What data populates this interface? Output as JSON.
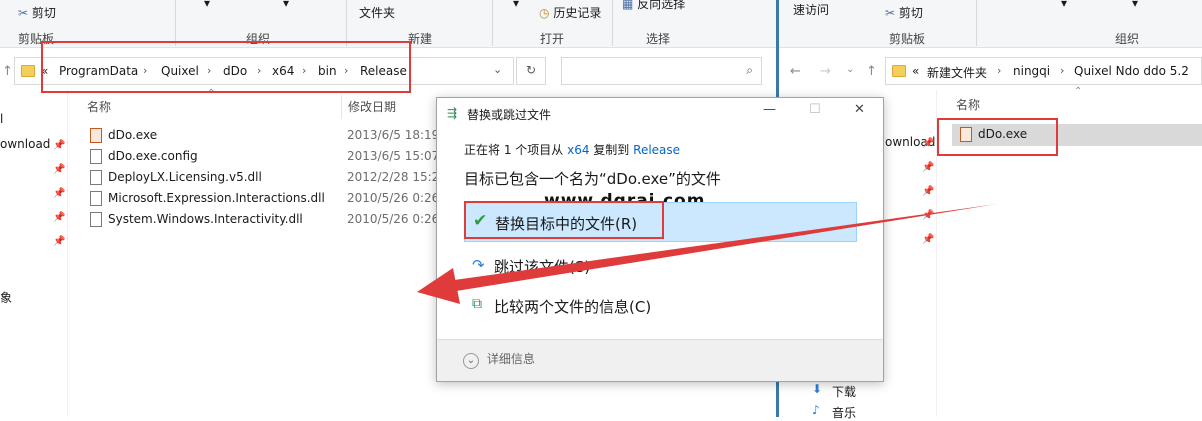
{
  "left_window": {
    "ribbon": {
      "cut": "剪切",
      "clipboard": "剪贴板",
      "organize": "组织",
      "folder": "文件夹",
      "new": "新建",
      "history": "历史记录",
      "open": "打开",
      "invert_select": "反向选择",
      "select": "选择"
    },
    "breadcrumb": [
      "«",
      "ProgramData",
      "Quixel",
      "dDo",
      "x64",
      "bin",
      "Release"
    ],
    "columns": {
      "name": "名称",
      "modified": "修改日期"
    },
    "side_labels": {
      "download": "ownload",
      "misc": "象"
    },
    "files": [
      {
        "name": "dDo.exe",
        "date": "2013/6/5 18:19",
        "type": "exe"
      },
      {
        "name": "dDo.exe.config",
        "date": "2013/6/5 15:07",
        "type": "file"
      },
      {
        "name": "DeployLX.Licensing.v5.dll",
        "date": "2012/2/28 15:24",
        "type": "dll"
      },
      {
        "name": "Microsoft.Expression.Interactions.dll",
        "date": "2010/5/26 0:26",
        "type": "dll"
      },
      {
        "name": "System.Windows.Interactivity.dll",
        "date": "2010/5/26 0:26",
        "type": "dll"
      }
    ]
  },
  "dialog": {
    "title": "替换或跳过文件",
    "info_prefix": "正在将 1 个项目从",
    "info_src": "x64",
    "info_mid": "复制到",
    "info_dst": "Release",
    "heading": "目标已包含一个名为“dDo.exe”的文件",
    "options": {
      "replace": "替换目标中的文件(R)",
      "skip": "跳过该文件(S)",
      "compare": "比较两个文件的信息(C)"
    },
    "details": "详细信息"
  },
  "watermark": "www.dgrai.com",
  "right_window": {
    "ribbon": {
      "quick_access": "速访问",
      "cut": "剪切",
      "clipboard": "剪贴板",
      "organize": "组织"
    },
    "breadcrumb": [
      "«",
      "新建文件夹",
      "ningqi",
      "Quixel Ndo ddo 5.2"
    ],
    "columns": {
      "name": "名称"
    },
    "files": [
      {
        "name": "dDo.exe",
        "type": "exe"
      }
    ],
    "side_labels": {
      "download_partial": "ownload",
      "downloads": "下载",
      "music": "音乐"
    }
  },
  "colors": {
    "accent_red": "#e03b3b",
    "link_blue": "#0066cc",
    "selection": "#cce8ff"
  }
}
